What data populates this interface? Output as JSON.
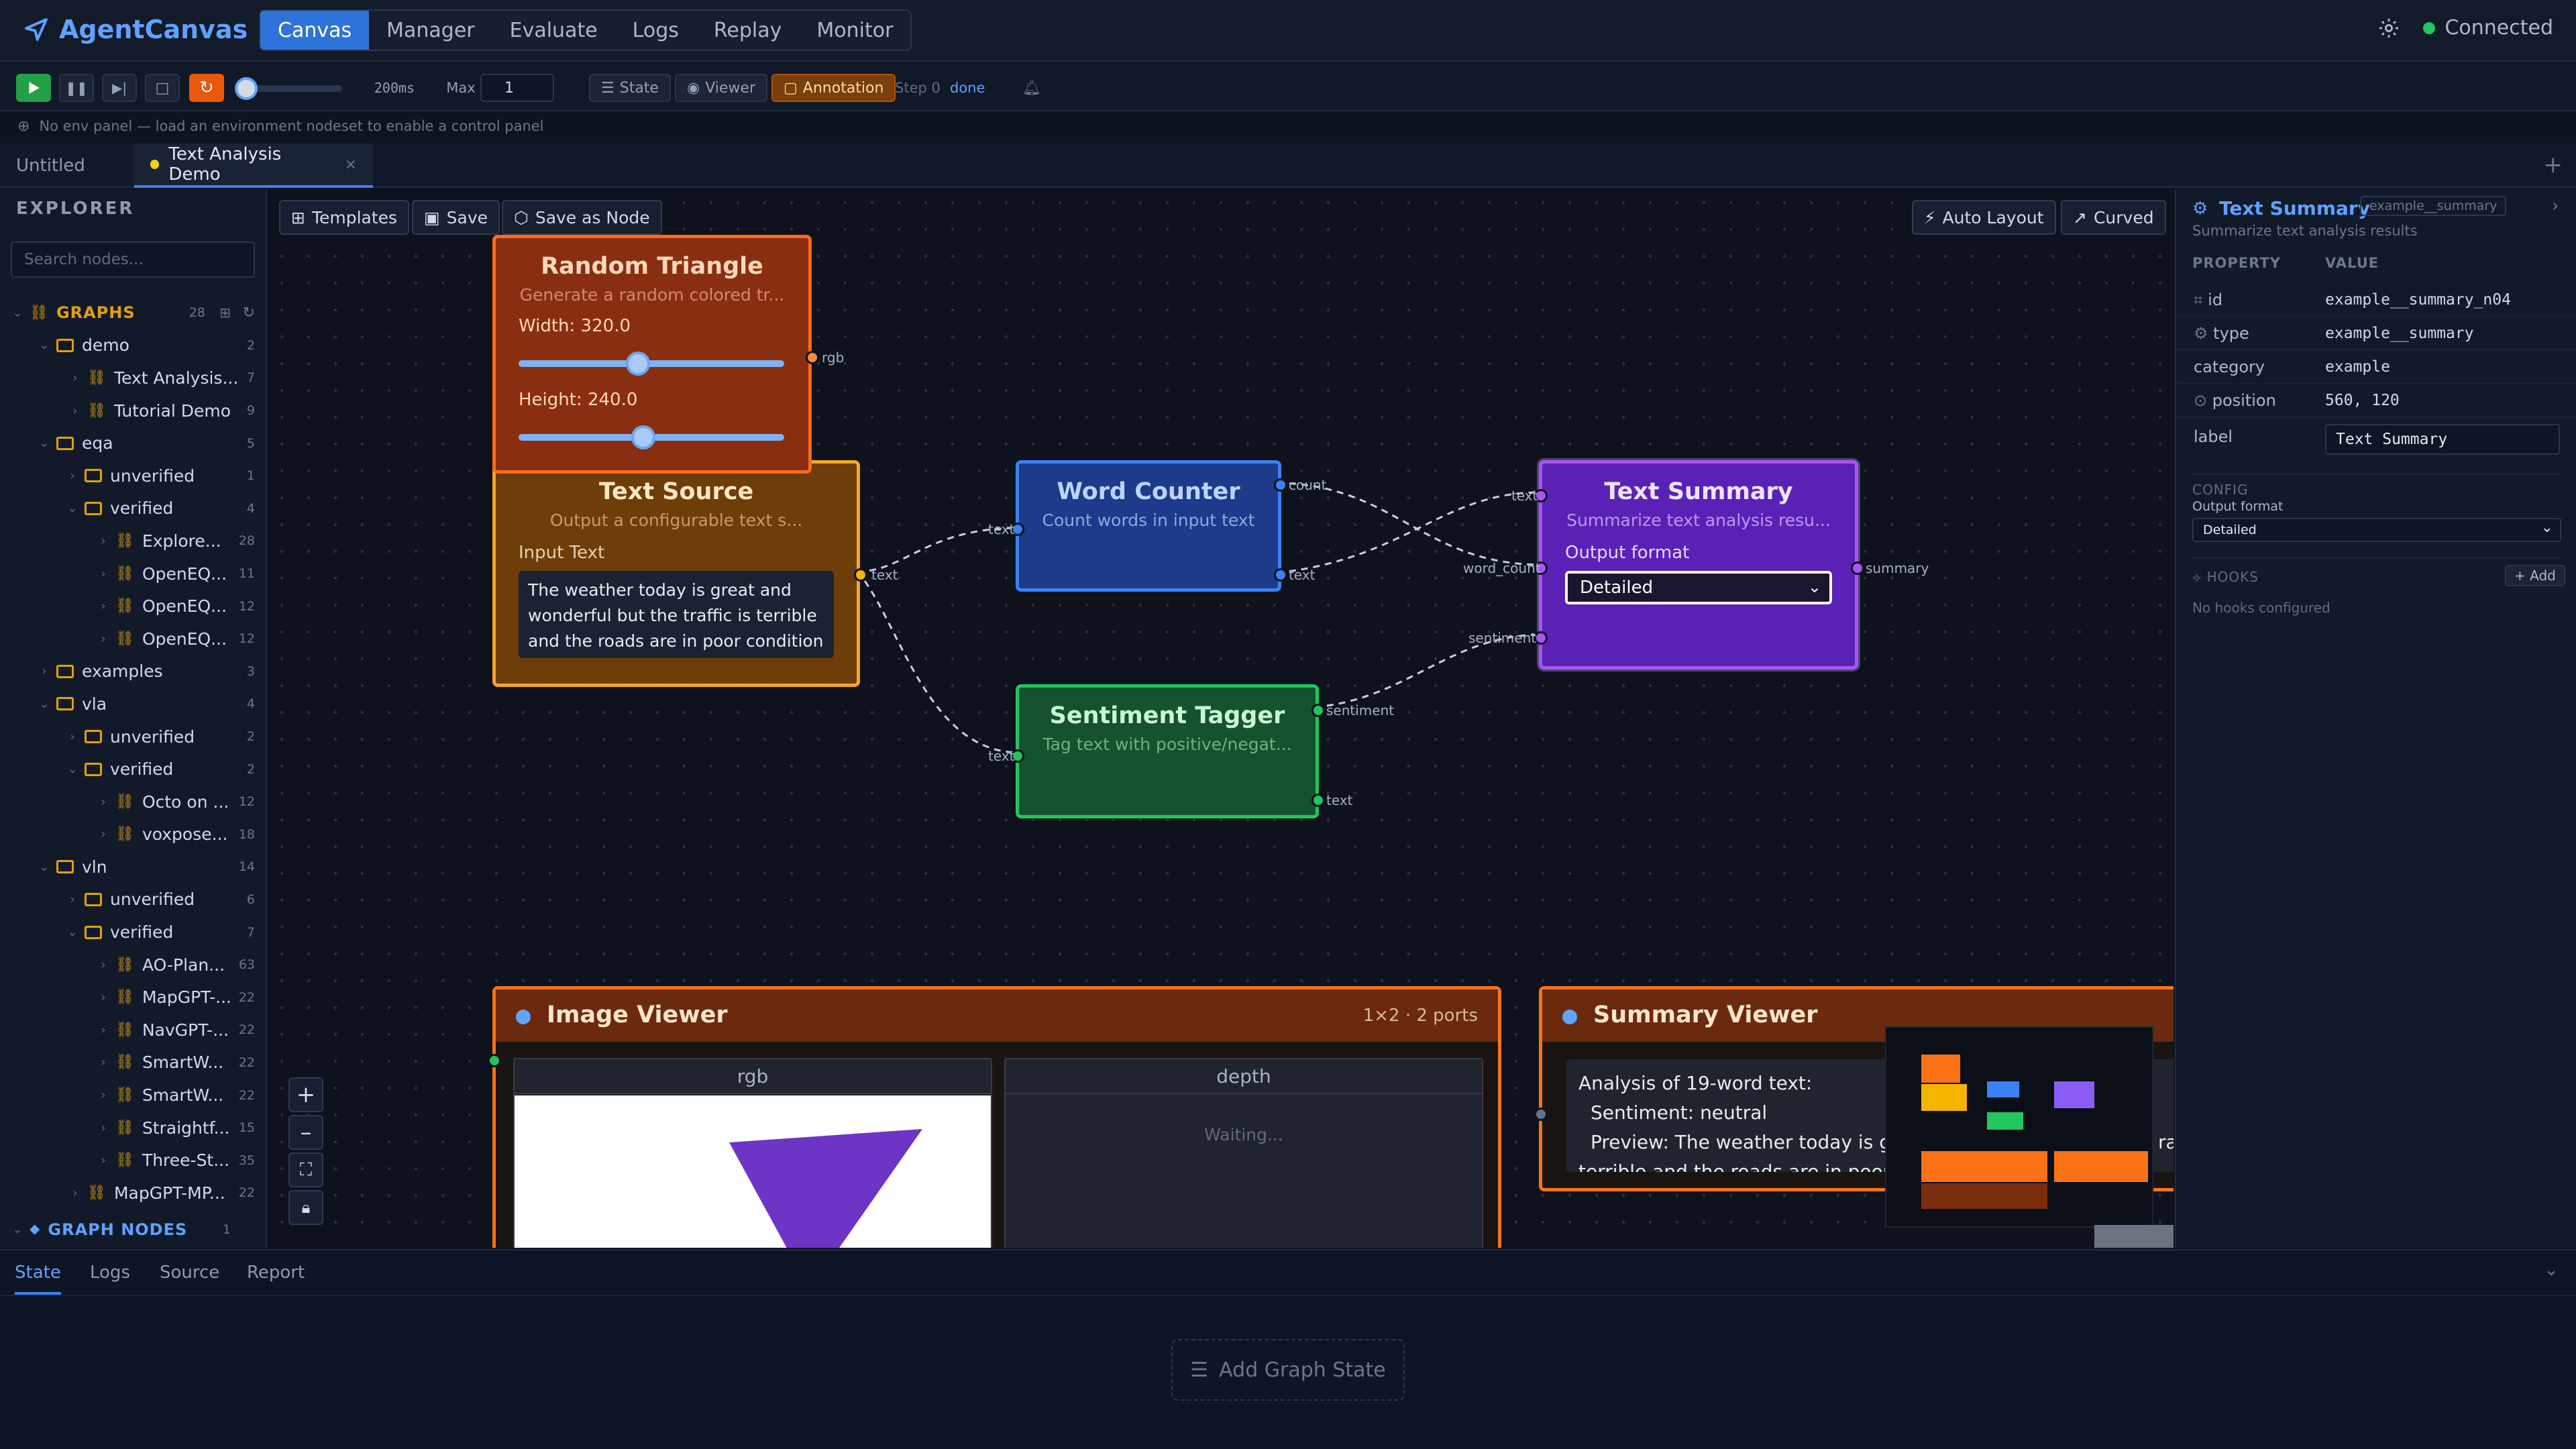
{
  "app": {
    "name": "AgentCanvas",
    "status": "Connected"
  },
  "nav": {
    "tabs": [
      "Canvas",
      "Manager",
      "Evaluate",
      "Logs",
      "Replay",
      "Monitor"
    ]
  },
  "toolbar": {
    "speed": "200ms",
    "max_label": "Max",
    "max_value": "1",
    "state": "State",
    "viewer": "Viewer",
    "annotation": "Annotation",
    "step": "Step 0",
    "step_status": "done"
  },
  "info": {
    "message": "No env panel — load an environment nodeset to enable a control panel"
  },
  "file_tabs": [
    "Untitled",
    "Text Analysis Demo"
  ],
  "explorer": {
    "title": "EXPLORER",
    "search_placeholder": "Search nodes...",
    "graphs_label": "GRAPHS",
    "graphs_count": "28",
    "graph_nodes_label": "GRAPH NODES",
    "graph_nodes_count": "1",
    "tree": [
      {
        "label": "demo",
        "count": "2"
      },
      {
        "label": "Text Analysis...",
        "count": "7"
      },
      {
        "label": "Tutorial Demo",
        "count": "9"
      },
      {
        "label": "eqa",
        "count": "5"
      },
      {
        "label": "unverified",
        "count": "1"
      },
      {
        "label": "verified",
        "count": "4"
      },
      {
        "label": "Explore...",
        "count": "28"
      },
      {
        "label": "OpenEQ...",
        "count": "11"
      },
      {
        "label": "OpenEQ...",
        "count": "12"
      },
      {
        "label": "OpenEQ...",
        "count": "12"
      },
      {
        "label": "examples",
        "count": "3"
      },
      {
        "label": "vla",
        "count": "4"
      },
      {
        "label": "unverified",
        "count": "2"
      },
      {
        "label": "verified",
        "count": "2"
      },
      {
        "label": "Octo on ...",
        "count": "12"
      },
      {
        "label": "voxpose...",
        "count": "18"
      },
      {
        "label": "vln",
        "count": "14"
      },
      {
        "label": "unverified",
        "count": "6"
      },
      {
        "label": "verified",
        "count": "7"
      },
      {
        "label": "AO-Plan...",
        "count": "63"
      },
      {
        "label": "MapGPT-...",
        "count": "22"
      },
      {
        "label": "NavGPT-...",
        "count": "22"
      },
      {
        "label": "SmartW...",
        "count": "22"
      },
      {
        "label": "SmartW...",
        "count": "22"
      },
      {
        "label": "Straightf...",
        "count": "15"
      },
      {
        "label": "Three-St...",
        "count": "35"
      },
      {
        "label": "MapGPT-MP...",
        "count": "22"
      }
    ]
  },
  "canvas": {
    "templates": "Templates",
    "save": "Save",
    "save_as_node": "Save as Node",
    "auto_layout": "Auto Layout",
    "curved": "Curved"
  },
  "nodes": {
    "random_triangle": {
      "title": "Random Triangle",
      "subtitle": "Generate a random colored tr...",
      "width_label": "Width: 320.0",
      "height_label": "Height: 240.0",
      "port_out": "rgb",
      "width_value": 0.45,
      "height_value": 0.47
    },
    "text_source": {
      "title": "Text Source",
      "subtitle": "Output a configurable text s...",
      "input_label": "Input Text",
      "input_value": "The weather today is great and wonderful but the traffic is terrible and the roads are in poor condition",
      "port_out": "text"
    },
    "word_counter": {
      "title": "Word Counter",
      "subtitle": "Count words in input text",
      "port_in": "text",
      "port_out_count": "count",
      "port_out_text": "text"
    },
    "sentiment_tagger": {
      "title": "Sentiment Tagger",
      "subtitle": "Tag text with positive/negat...",
      "port_in": "text",
      "port_out_sentiment": "sentiment",
      "port_out_text": "text"
    },
    "text_summary": {
      "title": "Text Summary",
      "subtitle": "Summarize text analysis resu...",
      "format_label": "Output format",
      "format_value": "Detailed",
      "port_text": "text",
      "port_word_count": "word_count",
      "port_sentiment": "sentiment",
      "port_out": "summary"
    },
    "image_viewer": {
      "title": "Image Viewer",
      "meta": "1×2 · 2 ports",
      "col_rgb": "rgb",
      "col_depth": "depth",
      "waiting": "Waiting..."
    },
    "summary_viewer": {
      "title": "Summary Viewer",
      "line1": "Analysis of 19-word text:",
      "line2": "Sentiment: neutral",
      "line3": "Preview: The weather today is g",
      "line3_tail": "ra",
      "line4": "terrible and the roads are in poor"
    }
  },
  "inspector": {
    "title": "Text Summary",
    "badge": "example__summary",
    "description": "Summarize text analysis results",
    "col_property": "PROPERTY",
    "col_value": "VALUE",
    "rows": [
      {
        "key": "id",
        "value": "example__summary_n04"
      },
      {
        "key": "type",
        "value": "example__summary"
      },
      {
        "key": "category",
        "value": "example"
      },
      {
        "key": "position",
        "value": "560, 120"
      }
    ],
    "label_key": "label",
    "label_value": "Text Summary",
    "config_title": "CONFIG",
    "config_field": "Output format",
    "config_value": "Detailed",
    "hooks_title": "HOOKS",
    "add_hook": "+ Add",
    "no_hooks": "No hooks configured"
  },
  "bottom": {
    "tabs": [
      "State",
      "Logs",
      "Source",
      "Report"
    ],
    "add_state": "Add Graph State"
  }
}
